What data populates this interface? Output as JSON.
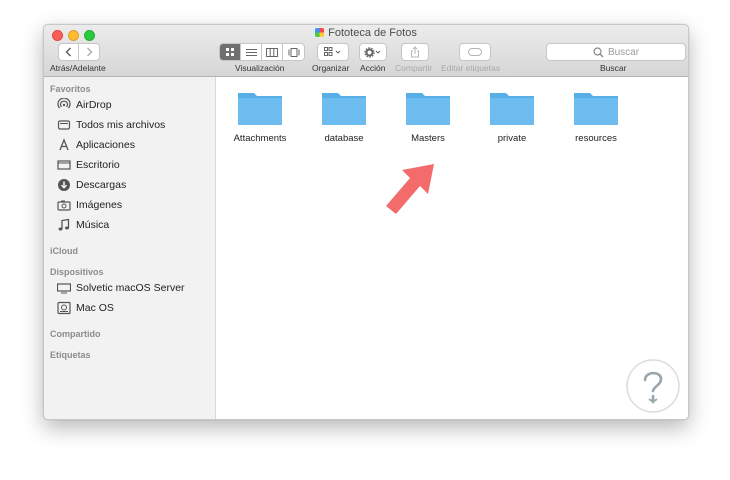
{
  "window": {
    "title": "Fototeca de Fotos"
  },
  "toolbar": {
    "nav_label": "Atrás/Adelante",
    "view_label": "Visualización",
    "organize_label": "Organizar",
    "action_label": "Acción",
    "share_label": "Compartir",
    "tags_label": "Editar etiquetas",
    "search_label": "Buscar",
    "search_placeholder": "Buscar"
  },
  "sidebar": {
    "favorites_header": "Favoritos",
    "favorites": [
      {
        "label": "AirDrop",
        "icon": "airdrop-icon"
      },
      {
        "label": "Todos mis archivos",
        "icon": "all-files-icon"
      },
      {
        "label": "Aplicaciones",
        "icon": "applications-icon"
      },
      {
        "label": "Escritorio",
        "icon": "desktop-icon"
      },
      {
        "label": "Descargas",
        "icon": "downloads-icon"
      },
      {
        "label": "Imágenes",
        "icon": "pictures-icon"
      },
      {
        "label": "Música",
        "icon": "music-icon"
      }
    ],
    "icloud_header": "iCloud",
    "devices_header": "Dispositivos",
    "devices": [
      {
        "label": "Solvetic macOS Server",
        "icon": "display-icon"
      },
      {
        "label": "Mac OS",
        "icon": "disk-icon"
      }
    ],
    "shared_header": "Compartido",
    "tags_header": "Etiquetas"
  },
  "folders": [
    {
      "name": "Attachments"
    },
    {
      "name": "database"
    },
    {
      "name": "Masters"
    },
    {
      "name": "private"
    },
    {
      "name": "resources"
    }
  ],
  "colors": {
    "folder": "#6cbcef",
    "folder_tab": "#58aee6",
    "arrow": "#f36b6b",
    "selected_view": "#6f6f6f"
  }
}
